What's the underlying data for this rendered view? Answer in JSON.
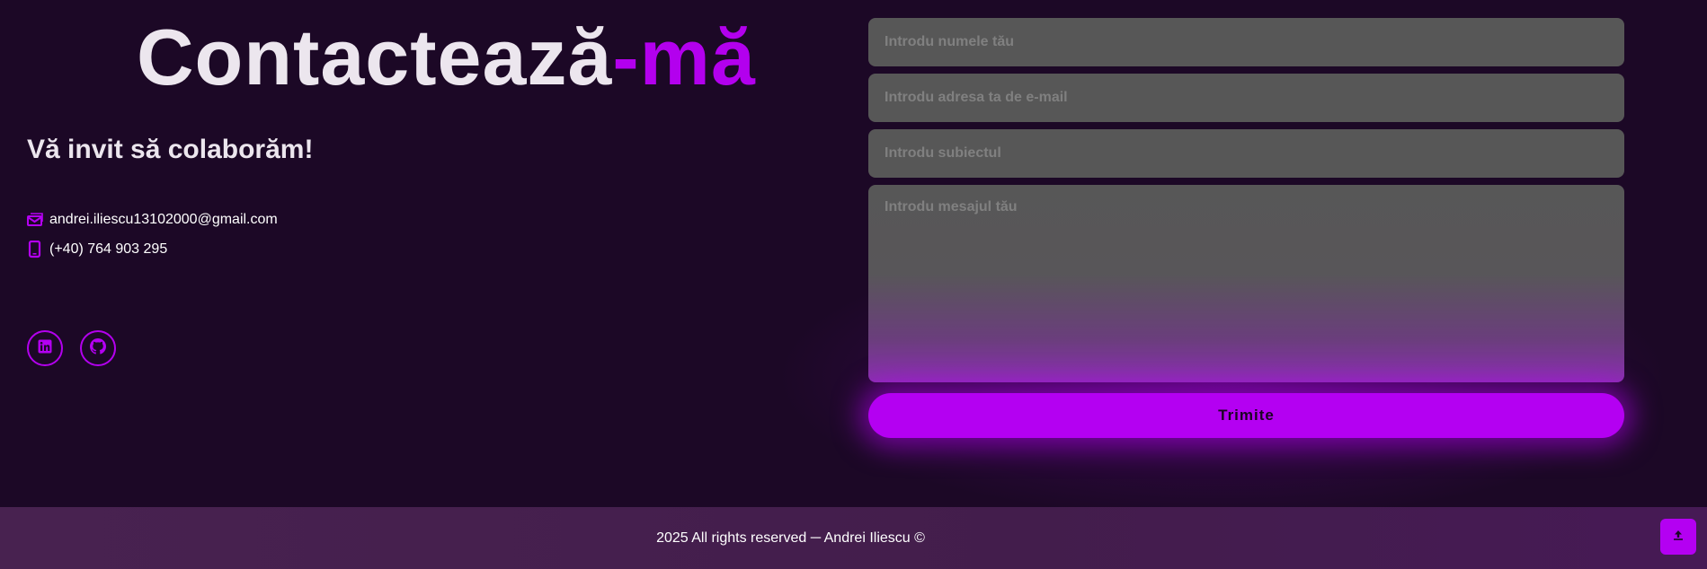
{
  "header": {
    "title_main": "Contactează",
    "title_accent": "-mă",
    "subtitle": "Vă invit să colaborăm!"
  },
  "contact": {
    "email": "andrei.iliescu13102000@gmail.com",
    "email_icon": "envelope-icon",
    "phone": "(+40) 764 903 295",
    "phone_icon": "phone-icon"
  },
  "social": [
    {
      "name": "linkedin",
      "icon": "linkedin-icon"
    },
    {
      "name": "github",
      "icon": "github-icon"
    }
  ],
  "form": {
    "name_placeholder": "Introdu numele tău",
    "email_placeholder": "Introdu adresa ta de e-mail",
    "subject_placeholder": "Introdu subiectul",
    "message_placeholder": "Introdu mesajul tău",
    "submit_label": "Trimite"
  },
  "footer": {
    "text": "2025 All rights reserved ─ Andrei Iliescu ©",
    "back_to_top_icon": "arrow-up-icon"
  },
  "colors": {
    "background": "#1c0826",
    "accent": "#b400f2",
    "text": "#ece6ee",
    "input_bg": "#575757",
    "footer_bg": "#482250"
  }
}
